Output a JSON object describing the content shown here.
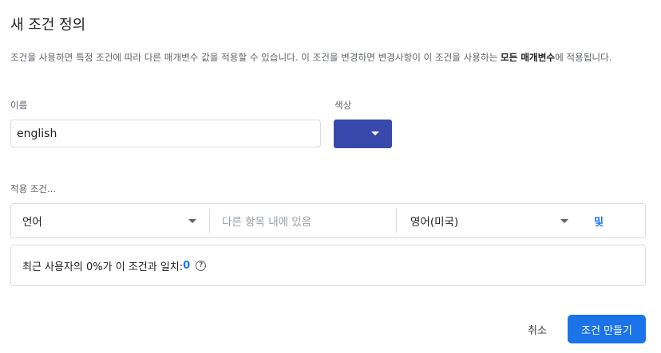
{
  "dialog": {
    "title": "새 조건 정의",
    "description_part1": "조건을 사용하면 특정 조건에 따라 다른 매개변수 값을 적용할 수 있습니다. 이 조건을 변경하면 변경사항이 이 조건을 사용하는 ",
    "description_bold": "모든 매개변수",
    "description_part2": "에 적용됩니다."
  },
  "name": {
    "label": "이름",
    "value": "english"
  },
  "color": {
    "label": "색상",
    "value": "#3949ab"
  },
  "applies": {
    "label": "적용 조건...",
    "property": "언어",
    "operator_placeholder": "다른 항목 내에 있음",
    "value": "영어(미국)",
    "and_label": "및"
  },
  "match_info": {
    "text": "최근 사용자의 0%가 이 조건과 일치:",
    "count": "0",
    "help_icon": "help-circle-icon"
  },
  "actions": {
    "cancel": "취소",
    "create": "조건 만들기"
  }
}
